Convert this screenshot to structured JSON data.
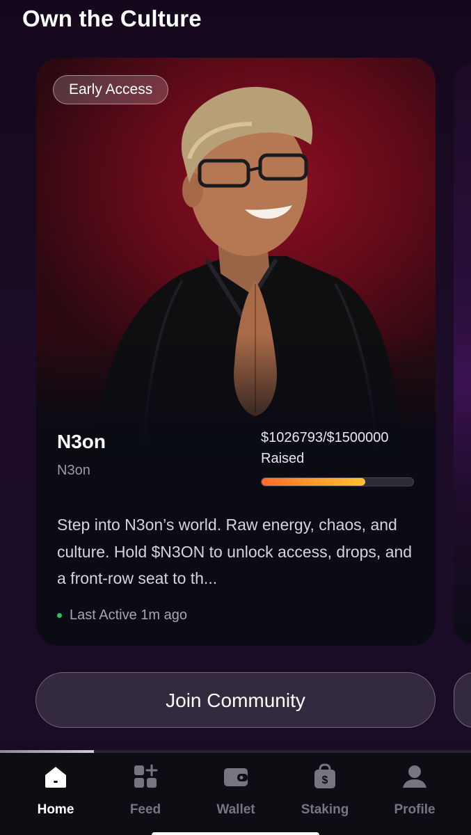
{
  "header": {
    "title": "Own the Culture"
  },
  "card": {
    "badge": "Early Access",
    "name": "N3on",
    "handle": "N3on",
    "raised_amount": "$1026793/$1500000",
    "raised_label": "Raised",
    "raised_progress": 0.685,
    "description": "Step into N3on’s world. Raw energy, chaos, and culture. Hold $N3ON to unlock access, drops, and a front-row seat to th...",
    "activity": "Last Active 1m ago",
    "colors": {
      "progress_start": "#ff6a2b",
      "progress_end": "#ffc22e",
      "active_dot": "#27c45d",
      "hero_bg": "#8e0f24"
    }
  },
  "actions": {
    "join_label": "Join Community"
  },
  "bottom_nav": {
    "items": [
      {
        "label": "Home",
        "icon": "home-icon",
        "active": true
      },
      {
        "label": "Feed",
        "icon": "feed-grid-icon",
        "active": false
      },
      {
        "label": "Wallet",
        "icon": "wallet-icon",
        "active": false
      },
      {
        "label": "Staking",
        "icon": "staking-bag-icon",
        "active": false
      },
      {
        "label": "Profile",
        "icon": "profile-icon",
        "active": false
      }
    ]
  }
}
